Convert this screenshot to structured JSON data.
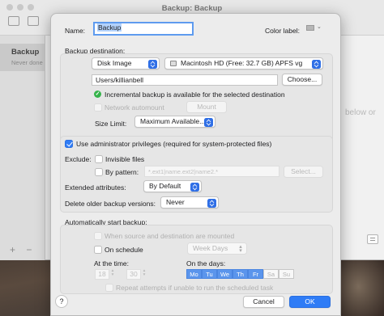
{
  "main_window": {
    "title": "Backup: Backup",
    "sidebar_item_title": "Backup",
    "sidebar_item_subtitle": "Never done",
    "background_hint": "below or",
    "add_label": "+",
    "remove_label": "−"
  },
  "sheet": {
    "name_label": "Name:",
    "name_value": "Backup",
    "color_label": "Color label:",
    "destination_header": "Backup destination:",
    "dest_type": "Disk Image",
    "dest_volume": "Macintosh HD (Free: 32.7 GB) APFS vg",
    "dest_path": "Users/killianbell",
    "choose_button": "Choose...",
    "incremental_status": "Incremental backup is available for the selected destination",
    "network_automount": "Network automount",
    "mount_button": "Mount",
    "size_limit_label": "Size Limit:",
    "size_limit_value": "Maximum Available...",
    "admin_privileges": "Use administrator privileges (required for system-protected files)",
    "exclude_label": "Exclude:",
    "invisible_files": "Invisible files",
    "by_pattern": "By pattern:",
    "pattern_placeholder": "*.ext1|name.ext2|name2.*",
    "select_button": "Select...",
    "extended_attributes_label": "Extended attributes:",
    "extended_attributes_value": "By Default",
    "delete_older_label": "Delete older backup versions:",
    "delete_older_value": "Never",
    "auto_start_header": "Automatically start backup:",
    "when_mounted": "When source and destination are mounted",
    "on_schedule": "On schedule",
    "schedule_value": "Week Days",
    "at_time_label": "At the time:",
    "hour": "18",
    "minute": "30",
    "on_days_label": "On the days:",
    "days": [
      "Mo",
      "Tu",
      "We",
      "Th",
      "Fr",
      "Sa",
      "Su"
    ],
    "days_selected": [
      true,
      true,
      true,
      true,
      true,
      false,
      false
    ],
    "repeat_attempts": "Repeat attempts if unable to run the scheduled task",
    "help_label": "?",
    "cancel_button": "Cancel",
    "ok_button": "OK"
  },
  "colors": {
    "accent": "#2f7cf6",
    "focus_ring": "#5e9bef",
    "status_ok": "#35b34a"
  }
}
